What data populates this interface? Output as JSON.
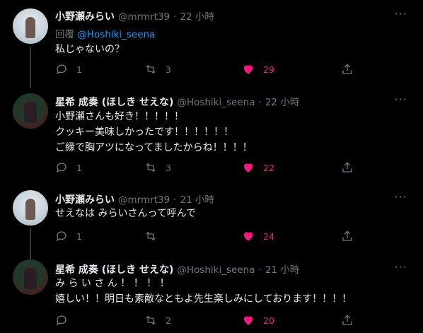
{
  "tweets": [
    {
      "name": "小野瀬みらい",
      "handle": "@mrmrt39",
      "dot": "·",
      "time": "22 小時",
      "reply_prefix": "回覆",
      "reply_to": "@Hoshiki_seena",
      "body": "私じゃないの？",
      "replies": "1",
      "retweets": "3",
      "likes": "29",
      "liked": true
    },
    {
      "name": "星希 成奏 (ほしき せえな)",
      "handle": "@Hoshiki_seena",
      "dot": "·",
      "time": "22 小時",
      "body": "小野瀬さんも好き！！！！！\nクッキー美味しかったです！！！！！！\nご縁で胸アツになってましたからね！！！！",
      "replies": "1",
      "retweets": "3",
      "likes": "22",
      "liked": true
    },
    {
      "name": "小野瀬みらい",
      "handle": "@mrmrt39",
      "dot": "·",
      "time": "21 小時",
      "body": "せえなは みらいさんって呼んで",
      "replies": "1",
      "retweets": "",
      "likes": "24",
      "liked": true
    },
    {
      "name": "星希 成奏 (ほしき せえな)",
      "handle": "@Hoshiki_seena",
      "dot": "·",
      "time": "21 小時",
      "body": "み ら い さ ん ！ ！ ！ ！\n嬉しい！！明日も素敵なともよ先生楽しみにしております！！！！",
      "replies": "",
      "retweets": "2",
      "likes": "20",
      "liked": true
    }
  ],
  "more_glyph": "···",
  "colors": {
    "background": "#000000",
    "text": "#e7e9ea",
    "muted": "#71767b",
    "link": "#1d9bf0",
    "like": "#f91880",
    "thread_line": "#333639"
  },
  "icons": [
    "reply-icon",
    "retweet-icon",
    "like-icon",
    "share-icon",
    "more-icon"
  ]
}
